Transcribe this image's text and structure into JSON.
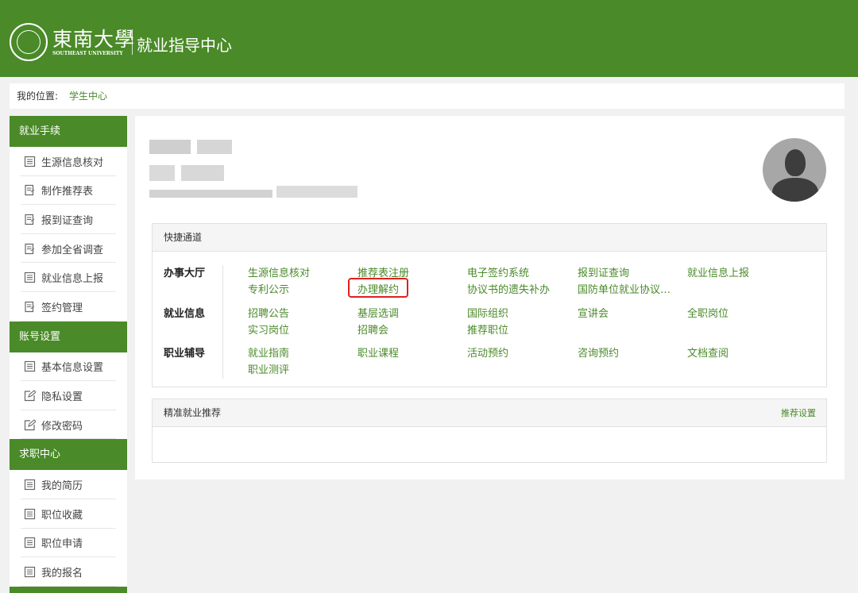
{
  "header": {
    "university_cn": "東南大學",
    "university_en": "SOUTHEAST UNIVERSITY",
    "center": "就业指导中心"
  },
  "location": {
    "label": "我的位置:",
    "crumb": "学生中心"
  },
  "sidebar": {
    "sections": [
      {
        "title": "就业手续",
        "items": [
          "生源信息核对",
          "制作推荐表",
          "报到证查询",
          "参加全省调查",
          "就业信息上报",
          "签约管理"
        ]
      },
      {
        "title": "账号设置",
        "items": [
          "基本信息设置",
          "隐私设置",
          "修改密码"
        ]
      },
      {
        "title": "求职中心",
        "items": [
          "我的简历",
          "职位收藏",
          "职位申请",
          "我的报名"
        ]
      }
    ]
  },
  "quick": {
    "title": "快捷通道",
    "groups": [
      {
        "label": "办事大厅",
        "links": [
          "生源信息核对",
          "推荐表注册",
          "电子签约系统",
          "报到证查询",
          "就业信息上报",
          "专利公示",
          "办理解约",
          "协议书的遗失补办",
          "国防单位就业协议…"
        ]
      },
      {
        "label": "就业信息",
        "links": [
          "招聘公告",
          "基层选调",
          "国际组织",
          "宣讲会",
          "全职岗位",
          "实习岗位",
          "招聘会",
          "推荐职位"
        ]
      },
      {
        "label": "职业辅导",
        "links": [
          "就业指南",
          "职业课程",
          "活动预约",
          "咨询预约",
          "文档查阅",
          "职业测评"
        ]
      }
    ]
  },
  "recommend": {
    "title": "精准就业推荐",
    "settings": "推荐设置"
  },
  "colors": {
    "brand": "#4a8a28",
    "highlight": "#e02020"
  }
}
